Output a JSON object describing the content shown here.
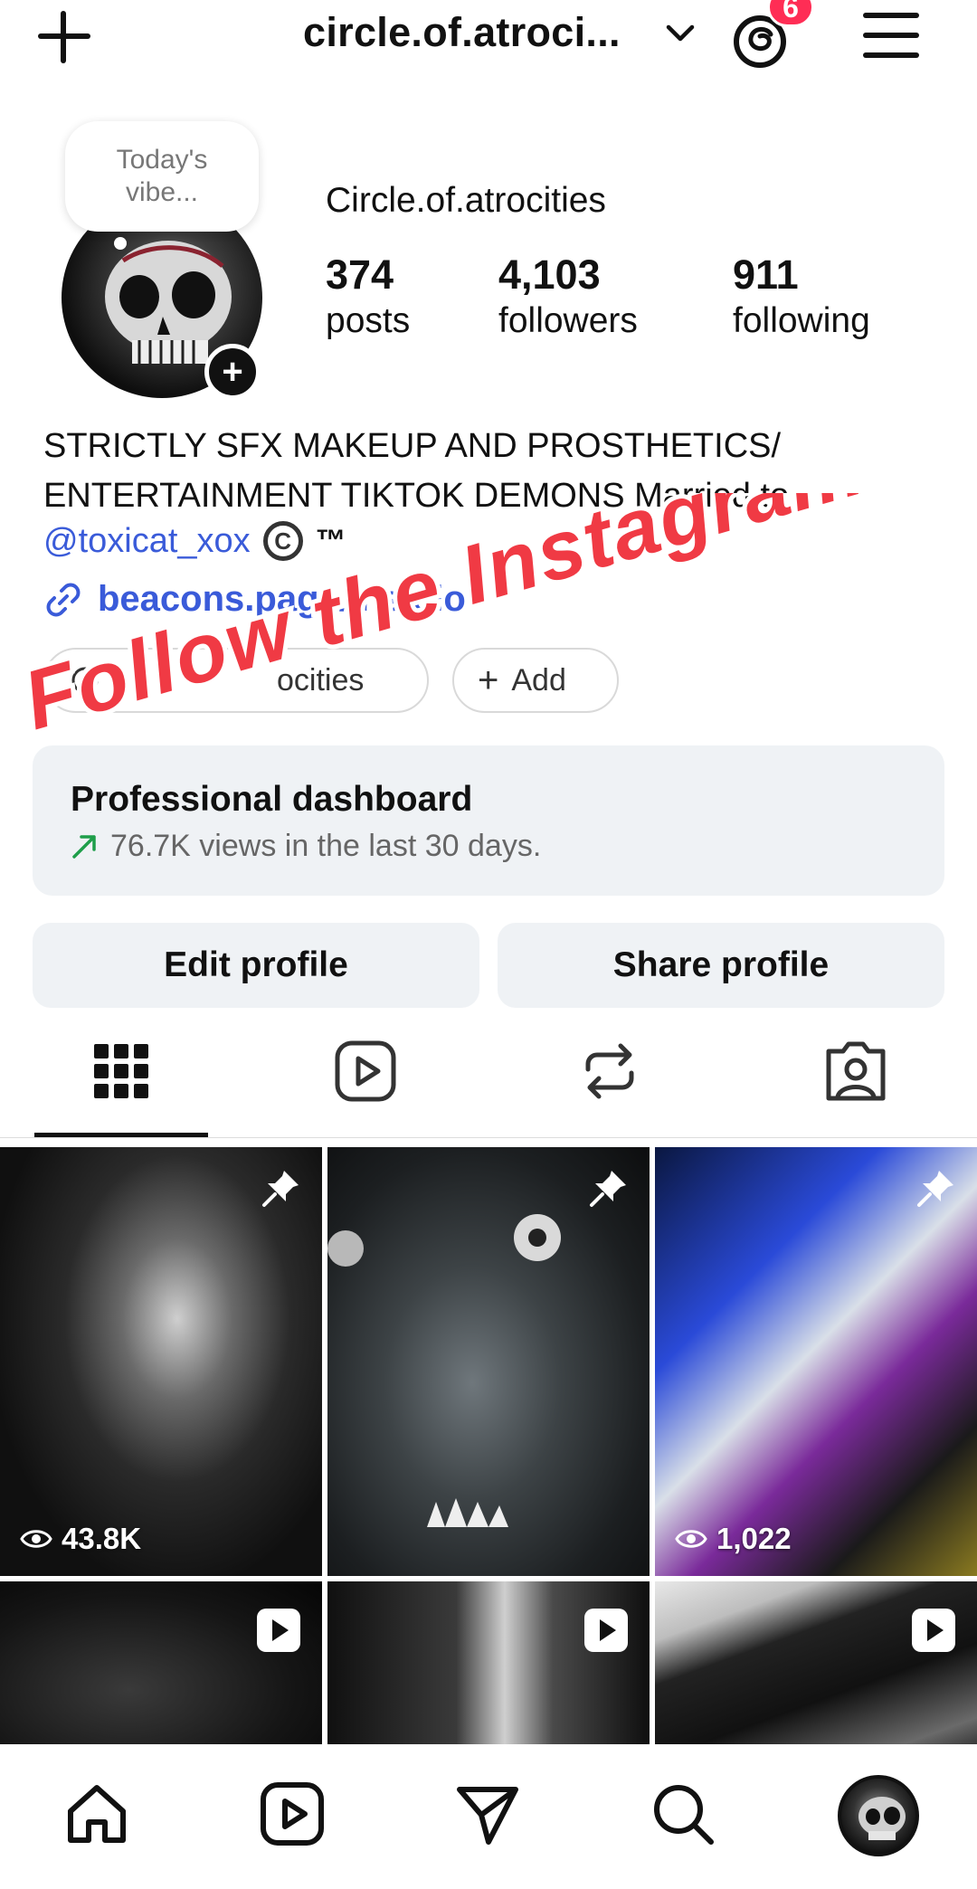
{
  "header": {
    "username": "circle.of.atroci...",
    "notification_count": "6"
  },
  "profile": {
    "note": "Today's vibe...",
    "display_name": "Circle.of.atrocities",
    "stats": [
      {
        "value": "374",
        "label": "posts"
      },
      {
        "value": "4,103",
        "label": "followers"
      },
      {
        "value": "911",
        "label": "following"
      }
    ],
    "bio_line1": "STRICTLY SFX MAKEUP AND PROSTHETICS/",
    "bio_line2": "ENTERTAINMENT TIKTOK DEMONS Married to",
    "mention": "@toxicat_xox",
    "mention_extra": "™",
    "link": "beacons.page/insidio",
    "threads_pill": "ocities",
    "add_pill": "Add"
  },
  "overlay_text": "Follow the Instagram",
  "dashboard": {
    "title": "Professional dashboard",
    "subtitle": "76.7K views in the last 30 days."
  },
  "buttons": {
    "edit": "Edit profile",
    "share": "Share profile"
  },
  "tabs": [
    "grid-icon",
    "reels-icon",
    "reposts-icon",
    "tagged-icon"
  ],
  "grid": [
    {
      "views": "43.8K",
      "pinned": true
    },
    {
      "views": "",
      "pinned": true
    },
    {
      "views": "1,022",
      "pinned": true
    },
    {
      "reel": true
    },
    {
      "reel": true
    },
    {
      "reel": true
    }
  ],
  "colors": {
    "link_blue": "#3a5bd9",
    "badge_red": "#ff2d55",
    "overlay_red": "#f03a44",
    "panel_gray": "#eff2f5",
    "trend_green": "#1e9e4a"
  }
}
